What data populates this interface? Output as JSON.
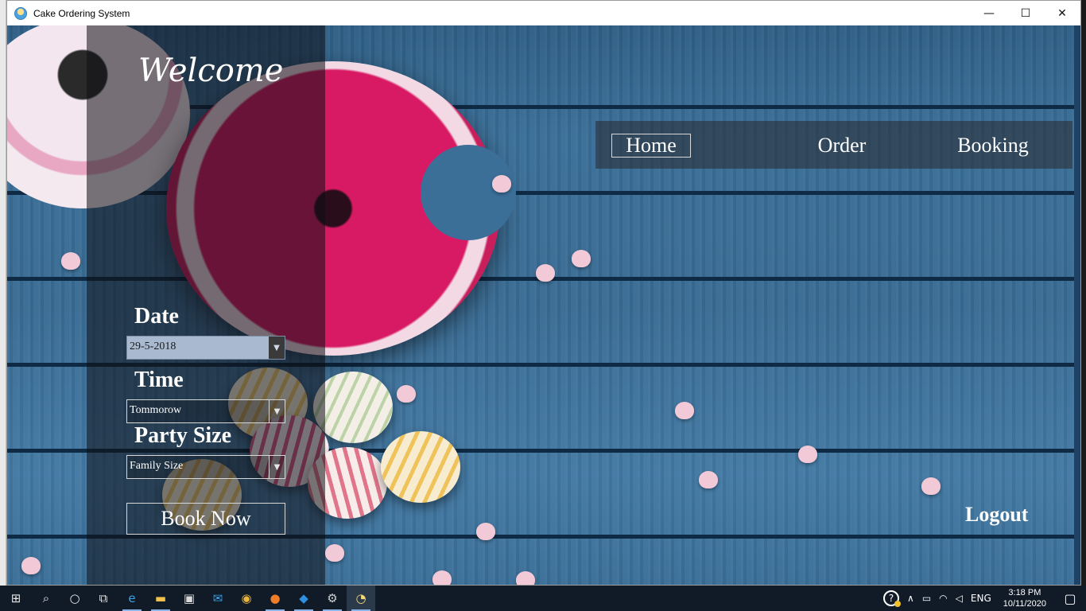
{
  "window": {
    "title": "Cake Ordering System",
    "controls": {
      "minimize": "—",
      "maximize": "☐",
      "close": "✕"
    }
  },
  "app": {
    "welcome": "Welcome",
    "nav": {
      "home": "Home",
      "order": "Order",
      "booking": "Booking"
    },
    "form": {
      "date_label": "Date",
      "date_value": "29-5-2018",
      "time_label": "Time",
      "time_value": "Tommorow",
      "party_label": "Party Size",
      "party_value": "Family Size",
      "dropdown_arrow": "▼",
      "book_button": "Book Now"
    },
    "logout": "Logout",
    "colors": {
      "background_wood": "#3b6f98",
      "panel_overlay": "#0f0f14",
      "text": "#ffffff",
      "date_field": "#a9bad0"
    }
  },
  "taskbar": {
    "pinned": [
      {
        "name": "start-icon",
        "glyph": "⊞"
      },
      {
        "name": "search-icon",
        "glyph": "⌕"
      },
      {
        "name": "cortana-icon",
        "glyph": "○"
      },
      {
        "name": "task-view-icon",
        "glyph": "⧉"
      },
      {
        "name": "edge-icon",
        "glyph": "e"
      },
      {
        "name": "file-explorer-icon",
        "glyph": "▬"
      },
      {
        "name": "store-icon",
        "glyph": "▣"
      },
      {
        "name": "mail-icon",
        "glyph": "✉"
      },
      {
        "name": "chrome-icon",
        "glyph": "◉"
      },
      {
        "name": "firefox-icon",
        "glyph": "●"
      },
      {
        "name": "vscode-icon",
        "glyph": "◆"
      },
      {
        "name": "settings-icon",
        "glyph": "⚙"
      },
      {
        "name": "cake-app-icon",
        "glyph": "◔"
      }
    ],
    "tray": {
      "help": "?",
      "chevron": "∧",
      "battery": "▭",
      "wifi": "◠",
      "volume": "◁",
      "language": "ENG",
      "time": "3:18 PM",
      "date": "10/11/2020",
      "notifications": "▢"
    }
  }
}
